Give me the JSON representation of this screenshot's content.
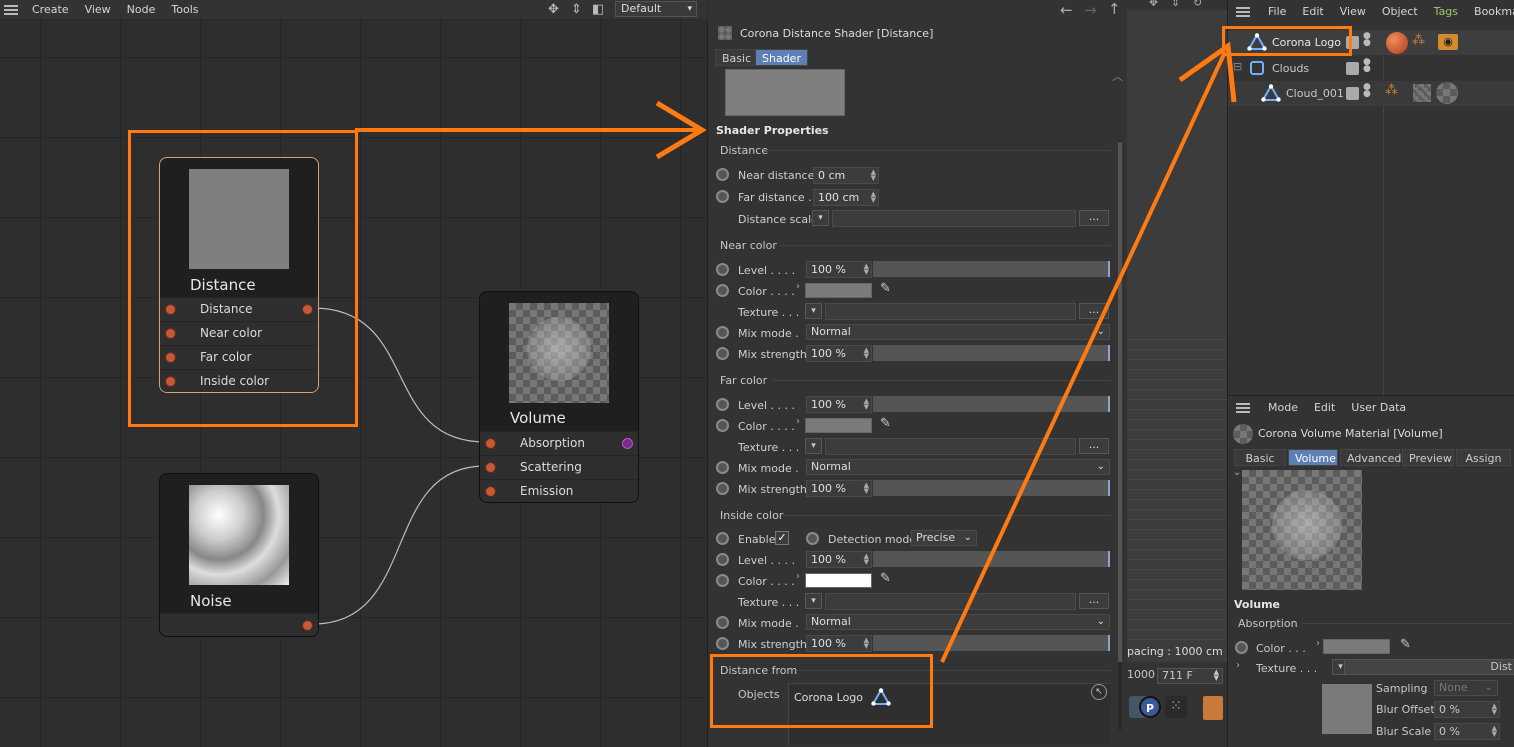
{
  "node_editor": {
    "menu": [
      "Create",
      "View",
      "Node",
      "Tools"
    ],
    "layout_dropdown": "Default",
    "nodes": {
      "distance": {
        "title": "Distance",
        "ports": [
          "Distance",
          "Near color",
          "Far color",
          "Inside color"
        ]
      },
      "volume": {
        "title": "Volume",
        "ports": [
          "Absorption",
          "Scattering",
          "Emission"
        ]
      },
      "noise": {
        "title": "Noise"
      }
    }
  },
  "attributes": {
    "header": "Corona Distance Shader [Distance]",
    "tabs": [
      "Basic",
      "Shader"
    ],
    "active_tab": "Shader",
    "section_title": "Shader Properties",
    "distance": {
      "label": "Distance",
      "near_distance_label": "Near distance",
      "near_distance": "0 cm",
      "far_distance_label": "Far distance .",
      "far_distance": "100 cm",
      "distance_scale_label": "Distance scale",
      "dots": "..."
    },
    "near_color": {
      "label": "Near color",
      "level_label": "Level . . . .",
      "level": "100 %",
      "color_label": "Color . . . .",
      "color": "#7a7a7a",
      "texture_label": "Texture . . .",
      "dots": "...",
      "mix_mode_label": "Mix mode .",
      "mix_mode": "Normal",
      "mix_strength_label": "Mix strength",
      "mix_strength": "100 %"
    },
    "far_color": {
      "label": "Far color",
      "level_label": "Level . . . .",
      "level": "100 %",
      "color_label": "Color . . . .",
      "color": "#7a7a7a",
      "texture_label": "Texture . . .",
      "dots": "...",
      "mix_mode_label": "Mix mode .",
      "mix_mode": "Normal",
      "mix_strength_label": "Mix strength",
      "mix_strength": "100 %"
    },
    "inside_color": {
      "label": "Inside color",
      "enable_label": "Enable",
      "enable": true,
      "detection_mode_label": "Detection mode",
      "detection_mode": "Precise",
      "level_label": "Level . . . .",
      "level": "100 %",
      "color_label": "Color . . . .",
      "color": "#ffffff",
      "texture_label": "Texture . . .",
      "dots": "...",
      "mix_mode_label": "Mix mode .",
      "mix_mode": "Normal",
      "mix_strength_label": "Mix strength",
      "mix_strength": "100 %"
    },
    "distance_from": {
      "label": "Distance from",
      "objects_label": "Objects",
      "object": "Corona Logo"
    }
  },
  "viewport": {
    "spacing": "pacing : 1000 cm",
    "left_value": "1000",
    "frame": "711 F"
  },
  "object_manager": {
    "menu": [
      "File",
      "Edit",
      "View",
      "Object",
      "Tags",
      "Bookmarks"
    ],
    "objects": [
      {
        "name": "Corona Logo"
      },
      {
        "name": "Clouds"
      },
      {
        "name": "Cloud_001"
      }
    ]
  },
  "material_manager": {
    "menu": [
      "Mode",
      "Edit",
      "User Data"
    ],
    "header": "Corona Volume Material [Volume]",
    "tabs": [
      "Basic",
      "Volume",
      "Advanced",
      "Preview",
      "Assign"
    ],
    "active_tab": "Volume",
    "section": "Volume",
    "absorption": {
      "label": "Absorption",
      "color_label": "Color . . .",
      "texture_label": "Texture . . .",
      "texture_value": "Dist",
      "sampling_label": "Sampling",
      "sampling": "None",
      "blur_offset_label": "Blur Offset",
      "blur_offset": "0 %",
      "blur_scale_label": "Blur Scale",
      "blur_scale": "0 %"
    }
  },
  "colors": {
    "annotation": "#ff7a10",
    "accent_tab": "#5d7fb5",
    "port": "#c25a38"
  }
}
